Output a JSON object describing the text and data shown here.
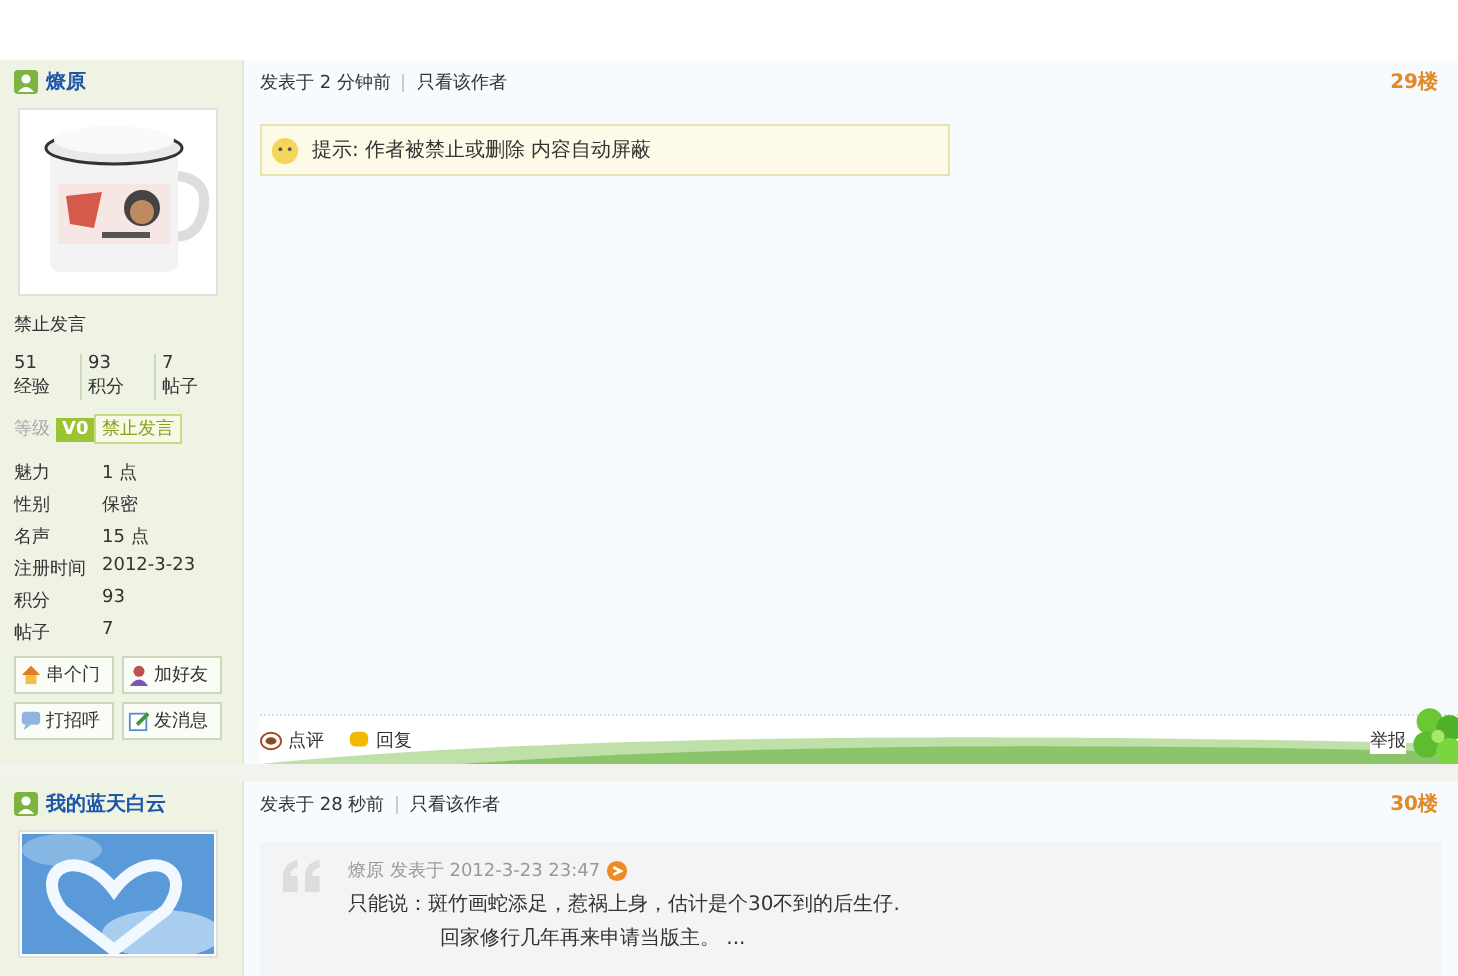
{
  "posts": [
    {
      "author": "燎原",
      "user_group": "禁止发言",
      "stats": [
        {
          "value": "51",
          "label": "经验"
        },
        {
          "value": "93",
          "label": "积分"
        },
        {
          "value": "7",
          "label": "帖子"
        }
      ],
      "level_label": "等级",
      "level_badge": "V0",
      "level_name": "禁止发言",
      "profile": [
        {
          "label": "魅力",
          "value": "1 点"
        },
        {
          "label": "性别",
          "value": "保密"
        },
        {
          "label": "名声",
          "value": "15 点"
        },
        {
          "label": "注册时间",
          "value": "2012-3-23"
        },
        {
          "label": "积分",
          "value": "93"
        },
        {
          "label": "帖子",
          "value": "7"
        }
      ],
      "actions": [
        {
          "label": "串个门"
        },
        {
          "label": "加好友"
        },
        {
          "label": "打招呼"
        },
        {
          "label": "发消息"
        }
      ],
      "posted": "发表于 2 分钟前",
      "only_author": "只看该作者",
      "floor": "29楼",
      "notice_label": "提示:",
      "notice": "作者被禁止或删除 内容自动屏蔽",
      "footer": [
        "点评",
        "回复"
      ],
      "report": "举报"
    },
    {
      "author": "我的蓝天白云",
      "posted": "发表于 28 秒前",
      "only_author": "只看该作者",
      "floor": "30楼",
      "quote": {
        "meta": "燎原 发表于 2012-3-23 23:47",
        "lines": [
          "只能说：斑竹画蛇添足，惹祸上身，估计是个30不到的后生仔.",
          "回家修行几年再来申请当版主。 ..."
        ]
      }
    }
  ]
}
